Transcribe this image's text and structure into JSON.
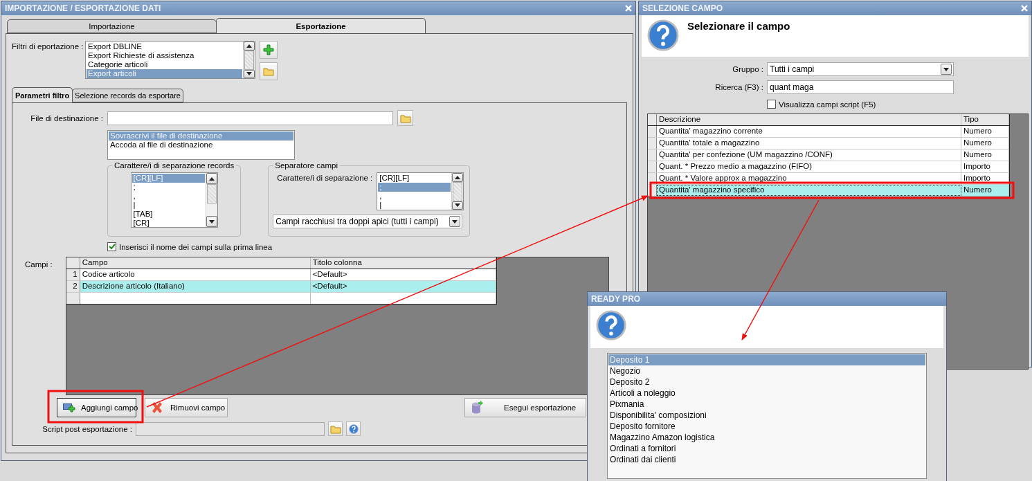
{
  "export_window": {
    "title": "IMPORTAZIONE / ESPORTAZIONE DATI",
    "tabs": [
      {
        "label": "Importazione",
        "selected": false
      },
      {
        "label": "Esportazione",
        "selected": true
      }
    ],
    "filters": {
      "label": "Filtri di eportazione :",
      "items": [
        {
          "label": "Export DBLINE",
          "selected": false
        },
        {
          "label": "Export Richieste di assistenza",
          "selected": false
        },
        {
          "label": "Categorie articoli",
          "selected": false
        },
        {
          "label": "Export articoli",
          "selected": true
        }
      ]
    },
    "subtabs": [
      {
        "label": "Parametri filtro",
        "selected": true
      },
      {
        "label": "Selezione records da esportare",
        "selected": false
      }
    ],
    "destination": {
      "label": "File di destinazione :"
    },
    "write_modes": [
      {
        "label": "Sovrascrivi il file di destinazione",
        "selected": true
      },
      {
        "label": "Accoda al file di destinazione",
        "selected": false
      }
    ],
    "record_separator": {
      "title": "Carattere/i di separazione records",
      "items": [
        {
          "label": "[CR][LF]",
          "selected": true
        },
        {
          "label": ";",
          "selected": false
        },
        {
          "label": ",",
          "selected": false
        },
        {
          "label": "|",
          "selected": false
        },
        {
          "label": "[TAB]",
          "selected": false
        },
        {
          "label": "[CR]",
          "selected": false
        }
      ]
    },
    "field_separator": {
      "title": "Separatore campi",
      "label": "Carattere/i di separazione :",
      "items": [
        {
          "label": "[CR][LF]",
          "selected": false
        },
        {
          "label": ";",
          "selected": true
        },
        {
          "label": ",",
          "selected": false
        },
        {
          "label": "|",
          "selected": false
        }
      ],
      "quoting": "Campi racchiusi tra doppi apici (tutti i campi)"
    },
    "header_checkbox": {
      "label": "Inserisci il nome dei campi sulla prima linea",
      "checked": true
    },
    "fields": {
      "label": "Campi :",
      "columns": [
        "Campo",
        "Titolo colonna"
      ],
      "rows": [
        {
          "number": "1",
          "field": "Codice articolo",
          "title": "<Default>",
          "selected": false
        },
        {
          "number": "2",
          "field": "Descrizione articolo (Italiano)",
          "title": "<Default>",
          "selected": true
        }
      ]
    },
    "buttons": {
      "add": "Aggiungi campo",
      "remove": "Rimuovi campo",
      "run": "Esegui esportazione"
    },
    "script": {
      "label": "Script post esportazione :"
    }
  },
  "field_window": {
    "title": "SELEZIONE CAMPO",
    "heading": "Selezionare il campo",
    "group": {
      "label": "Gruppo :",
      "value": "Tutti i campi"
    },
    "search": {
      "label": "Ricerca (F3) :",
      "value": "quant maga"
    },
    "script_checkbox": {
      "label": "Visualizza campi script (F5)",
      "checked": false
    },
    "columns": [
      "Descrizione",
      "Tipo"
    ],
    "rows": [
      {
        "description": "Quantita' magazzino corrente",
        "type": "Numero",
        "selected": false
      },
      {
        "description": "Quantita' totale a magazzino",
        "type": "Numero",
        "selected": false
      },
      {
        "description": "Quantita' per confezione (UM magazzino /CONF)",
        "type": "Numero",
        "selected": false
      },
      {
        "description": "Quant. * Prezzo medio a magazzino (FIFO)",
        "type": "Importo",
        "selected": false
      },
      {
        "description": "Quant. * Valore approx a magazzino",
        "type": "Importo",
        "selected": false
      },
      {
        "description": "Quantita' magazzino specifico",
        "type": "Numero",
        "selected": true
      }
    ]
  },
  "warehouse_window": {
    "title": "READY PRO",
    "items": [
      {
        "label": "Deposito 1",
        "selected": true
      },
      {
        "label": "Negozio",
        "selected": false
      },
      {
        "label": "Deposito 2",
        "selected": false
      },
      {
        "label": "Articoli a noleggio",
        "selected": false
      },
      {
        "label": "Pixmania",
        "selected": false
      },
      {
        "label": "Disponibilita' composizioni",
        "selected": false
      },
      {
        "label": "Deposito fornitore",
        "selected": false
      },
      {
        "label": "Magazzino Amazon logistica",
        "selected": false
      },
      {
        "label": "Ordinati a fornitori",
        "selected": false
      },
      {
        "label": "Ordinati dai clienti",
        "selected": false
      }
    ]
  }
}
